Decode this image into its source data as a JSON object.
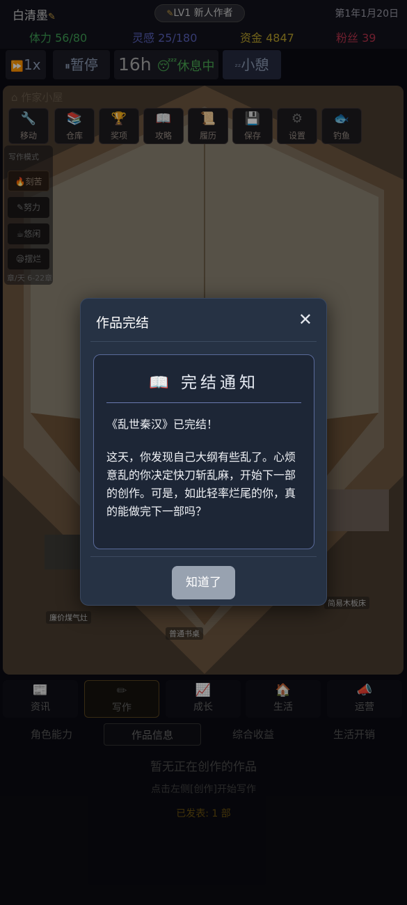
{
  "header": {
    "player_name": "白清墨",
    "pencil_glyph": "✎",
    "level": "LV1 新人作者",
    "date": "第1年1月20日",
    "stats": [
      {
        "label": "体力 56/80",
        "color": "#3e9f54"
      },
      {
        "label": "灵感 25/180",
        "color": "#5860b8"
      },
      {
        "label": "资金 4847",
        "color": "#b9a02b"
      },
      {
        "label": "粉丝 39",
        "color": "#b3334b"
      }
    ]
  },
  "controls": {
    "speed": "1x",
    "pause": "暂停",
    "hours": "16h",
    "rest_status": "休息中",
    "nap": "小憩"
  },
  "scene": {
    "room_title": "作家小屋",
    "tools": [
      {
        "label": "移动",
        "icon": "wrench-icon"
      },
      {
        "label": "仓库",
        "icon": "book-pile-icon"
      },
      {
        "label": "奖项",
        "icon": "trophy-icon"
      },
      {
        "label": "攻略",
        "icon": "open-book-icon"
      },
      {
        "label": "履历",
        "icon": "scroll-icon"
      },
      {
        "label": "保存",
        "icon": "floppy-icon"
      },
      {
        "label": "设置",
        "icon": "gear-icon"
      },
      {
        "label": "钓鱼",
        "icon": "fish-icon"
      }
    ],
    "mood_title": "写作模式",
    "moods": [
      {
        "label": "刻苦"
      },
      {
        "label": "努力"
      },
      {
        "label": "悠闲"
      },
      {
        "label": "摆烂"
      }
    ],
    "mood_speed": "章/天 6-22章",
    "labels": {
      "stove": "廉价煤气灶",
      "bed": "简易木板床",
      "table": "普通书桌"
    }
  },
  "main_tabs": [
    {
      "label": "资讯",
      "icon": "news-icon"
    },
    {
      "label": "写作",
      "icon": "pencil-icon"
    },
    {
      "label": "成长",
      "icon": "chart-icon"
    },
    {
      "label": "生活",
      "icon": "house-icon"
    },
    {
      "label": "运营",
      "icon": "megaphone-icon"
    }
  ],
  "sub_tabs": [
    "角色能力",
    "作品信息",
    "综合收益",
    "生活开销"
  ],
  "work_panel": {
    "empty_title": "暂无正在创作的作品",
    "empty_hint": "点击左侧[创作]开始写作",
    "published": "已发表: 1 部"
  },
  "modal": {
    "title": "作品完结",
    "close_glyph": "✕",
    "notice_heading": "📖 完结通知",
    "work_line": "《乱世秦汉》已完结！",
    "body": "这天，你发现自己大纲有些乱了。心烦意乱的你决定快刀斩乱麻，开始下一部的创作。可是，如此轻率烂尾的你，真的能做完下一部吗？",
    "confirm": "知道了"
  }
}
